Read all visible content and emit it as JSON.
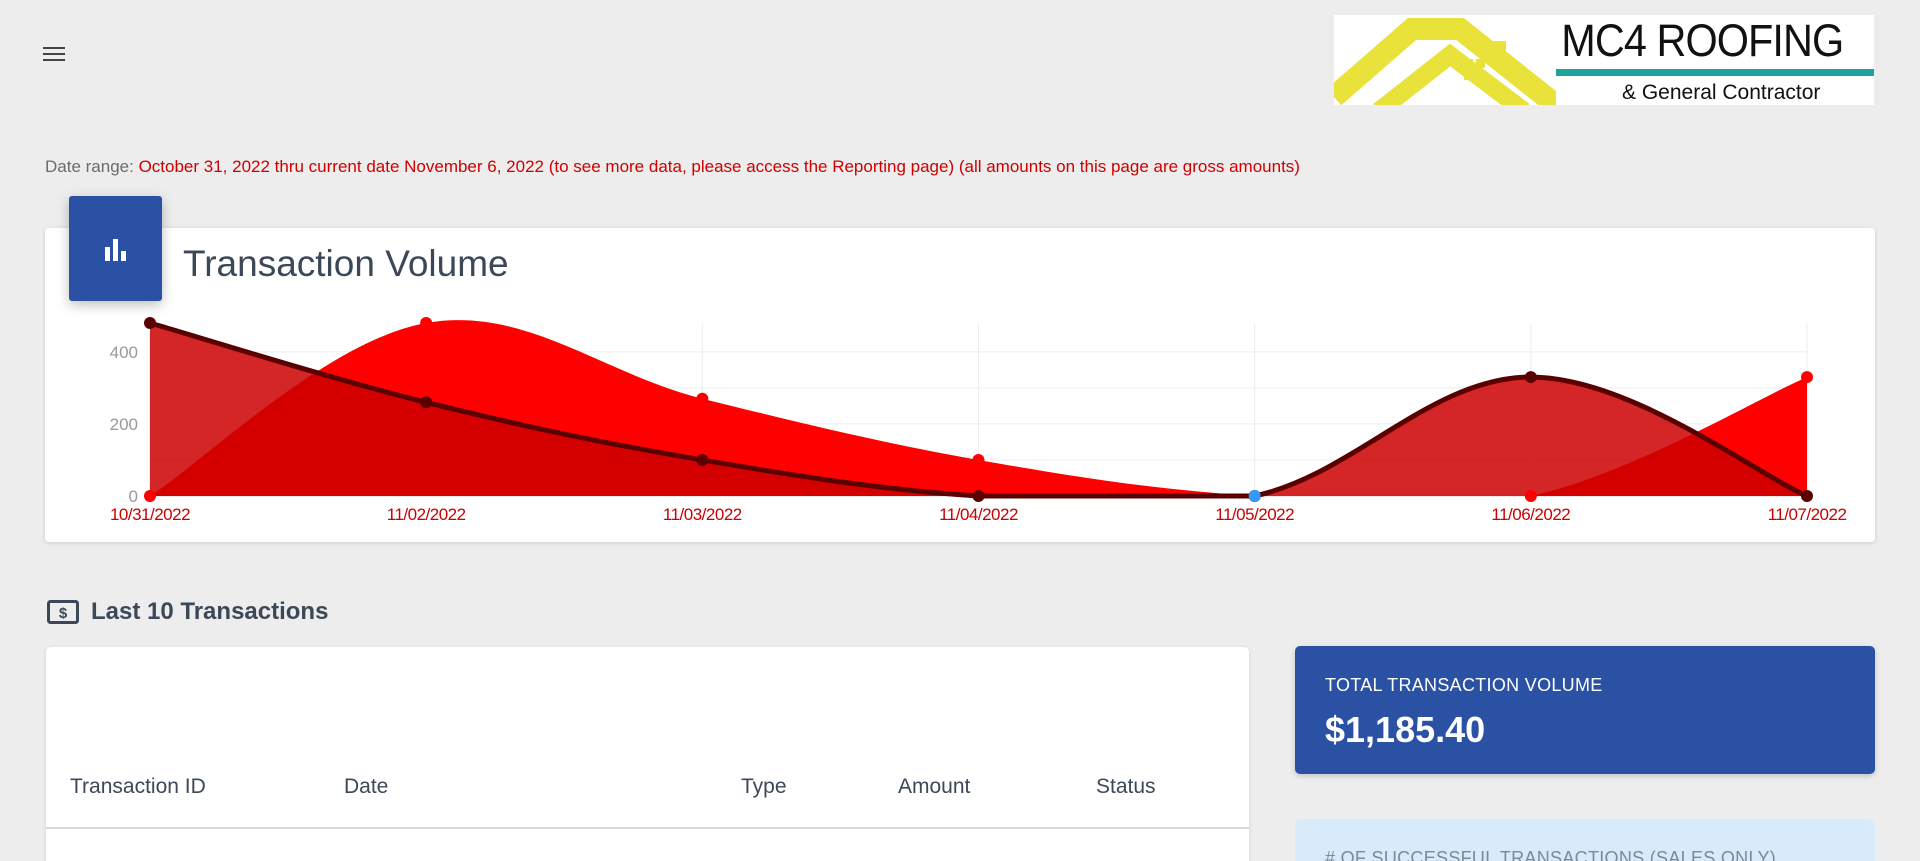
{
  "header": {
    "menu_icon": "hamburger-menu-icon",
    "logo": {
      "title": "MC4 ROOFING",
      "subtitle": "& General Contractor"
    }
  },
  "date_range": {
    "label": "Date range:",
    "value": "October 31, 2022 thru current date November 6, 2022 (to see more data, please access the Reporting page) (all amounts on this page are gross amounts)"
  },
  "chart_card": {
    "icon": "bar-chart-icon",
    "title": "Transaction Volume"
  },
  "chart_data": {
    "type": "area",
    "title": "Transaction Volume",
    "xlabel": "",
    "ylabel": "",
    "categories": [
      "10/31/2022",
      "11/02/2022",
      "11/03/2022",
      "11/04/2022",
      "11/05/2022",
      "11/06/2022",
      "11/07/2022"
    ],
    "yticks": [
      0,
      200,
      400
    ],
    "ylim": [
      0,
      480
    ],
    "grid": true,
    "series": [
      {
        "values": [
          0,
          480,
          270,
          100,
          0,
          0,
          330
        ],
        "color": "#ff0000"
      },
      {
        "values": [
          480,
          260,
          100,
          0,
          0,
          330,
          0
        ],
        "color": "#5a0000"
      }
    ],
    "baseline_fill_color": "#d6e8fb"
  },
  "transactions": {
    "icon": "dollar-bill-icon",
    "title": "Last 10 Transactions",
    "columns": [
      "Transaction ID",
      "Date",
      "Type",
      "Amount",
      "Status"
    ]
  },
  "stats": {
    "total_volume_label": "TOTAL TRANSACTION VOLUME",
    "total_volume_value": "$1,185.40",
    "successful_label": "# OF SUCCESSFUL TRANSACTIONS (SALES ONLY)"
  },
  "colors": {
    "primary": "#2a51a4",
    "accent_red": "#ff0000",
    "dark_red": "#5a0000",
    "light_blue": "#d8ebfb"
  }
}
